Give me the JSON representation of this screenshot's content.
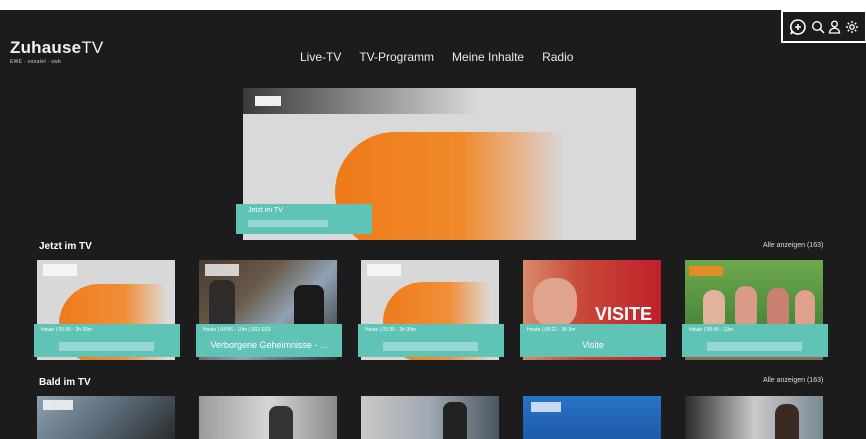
{
  "app": {
    "brand_main": "Zuhause",
    "brand_tv": "TV",
    "brand_sub": "EWE · osnatel · swb"
  },
  "nav": [
    {
      "label": "Live-TV"
    },
    {
      "label": "TV-Programm"
    },
    {
      "label": "Meine Inhalte"
    },
    {
      "label": "Radio"
    }
  ],
  "header_icons": [
    "add-chat-icon",
    "search-icon",
    "user-icon",
    "gear-icon"
  ],
  "hero": {
    "label": "Jetzt im TV",
    "accent": "#ef7a1a"
  },
  "sections": {
    "now": {
      "title": "Jetzt im TV",
      "all_link": "Alle anzeigen (163)",
      "cards": [
        {
          "meta": "Heute | 05:30 - 3h 30m",
          "title": ""
        },
        {
          "meta": "Heute | 04:55 - 10m | S02 E03",
          "title": "Verborgene Geheimnisse - ..."
        },
        {
          "meta": "Heute | 05:30 - 3h 30m",
          "title": ""
        },
        {
          "meta": "Heute | 08:22 - 3h 3m",
          "title": "Visite"
        },
        {
          "meta": "Heute | 08:40 - 13m",
          "title": ""
        }
      ]
    },
    "soon": {
      "title": "Bald im TV",
      "all_link": "Alle anzeigen (163)"
    }
  },
  "colors": {
    "background": "#1c1c1c",
    "teal_overlay": "#5fc3b5",
    "zdf_orange": "#ef7a1a"
  }
}
